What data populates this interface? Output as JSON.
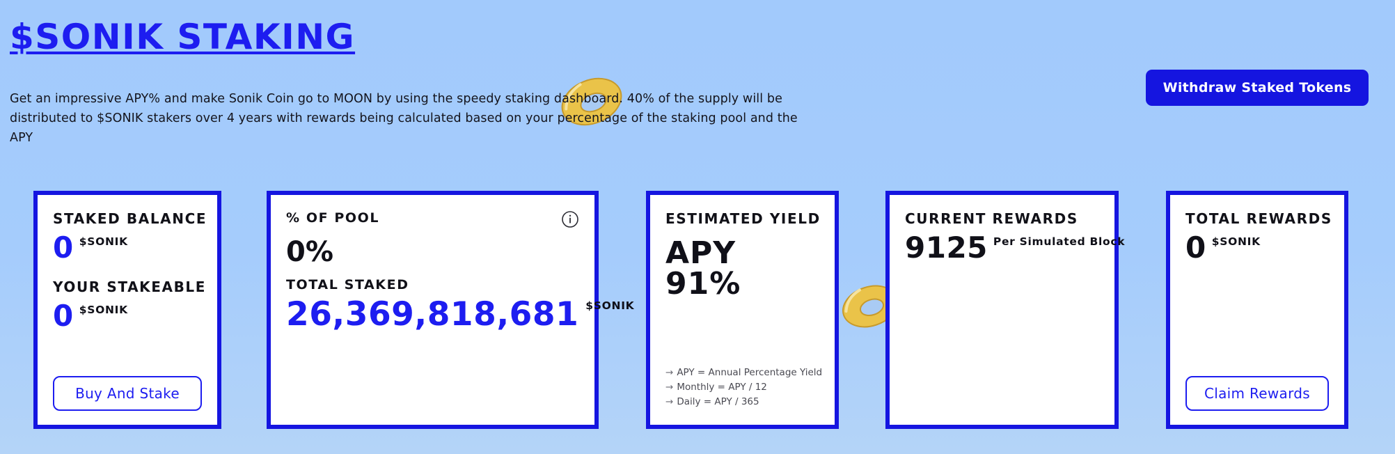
{
  "header": {
    "title": "$SONIK STAKING",
    "description": "Get an impressive APY% and make Sonik Coin go to MOON by using the speedy staking dashboard. 40% of the supply will be distributed to $SONIK stakers over 4 years with rewards being calculated based on your percentage of the staking pool and the APY",
    "withdraw_label": "Withdraw Staked Tokens"
  },
  "colors": {
    "accent_blue": "#1515e0",
    "value_blue": "#1d1df0",
    "card_bg": "#ffffff",
    "page_bg": "#a2cafc",
    "coin_gold": "#e3b93f"
  },
  "cards": {
    "staked_balance": {
      "heading": "STAKED BALANCE",
      "value": "0",
      "unit": "$SONIK",
      "sub_heading": "YOUR STAKEABLE",
      "sub_value": "0",
      "sub_unit": "$SONIK",
      "button_label": "Buy And Stake"
    },
    "pool": {
      "heading": "% OF POOL",
      "info_icon": "info-icon",
      "percent": "0%",
      "sub_heading": "TOTAL STAKED",
      "total_staked": "26,369,818,681",
      "total_unit": "$SONIK"
    },
    "yield": {
      "heading": "ESTIMATED YIELD",
      "value": "APY 91%",
      "notes": [
        "APY = Annual Percentage Yield",
        "Monthly = APY / 12",
        "Daily = APY / 365"
      ],
      "note_arrow": "→"
    },
    "current_rewards": {
      "heading": "CURRENT REWARDS",
      "value": "9125",
      "unit": "Per Simulated Block"
    },
    "total_rewards": {
      "heading": "TOTAL REWARDS",
      "value": "0",
      "unit": "$SONIK",
      "button_label": "Claim Rewards"
    }
  }
}
